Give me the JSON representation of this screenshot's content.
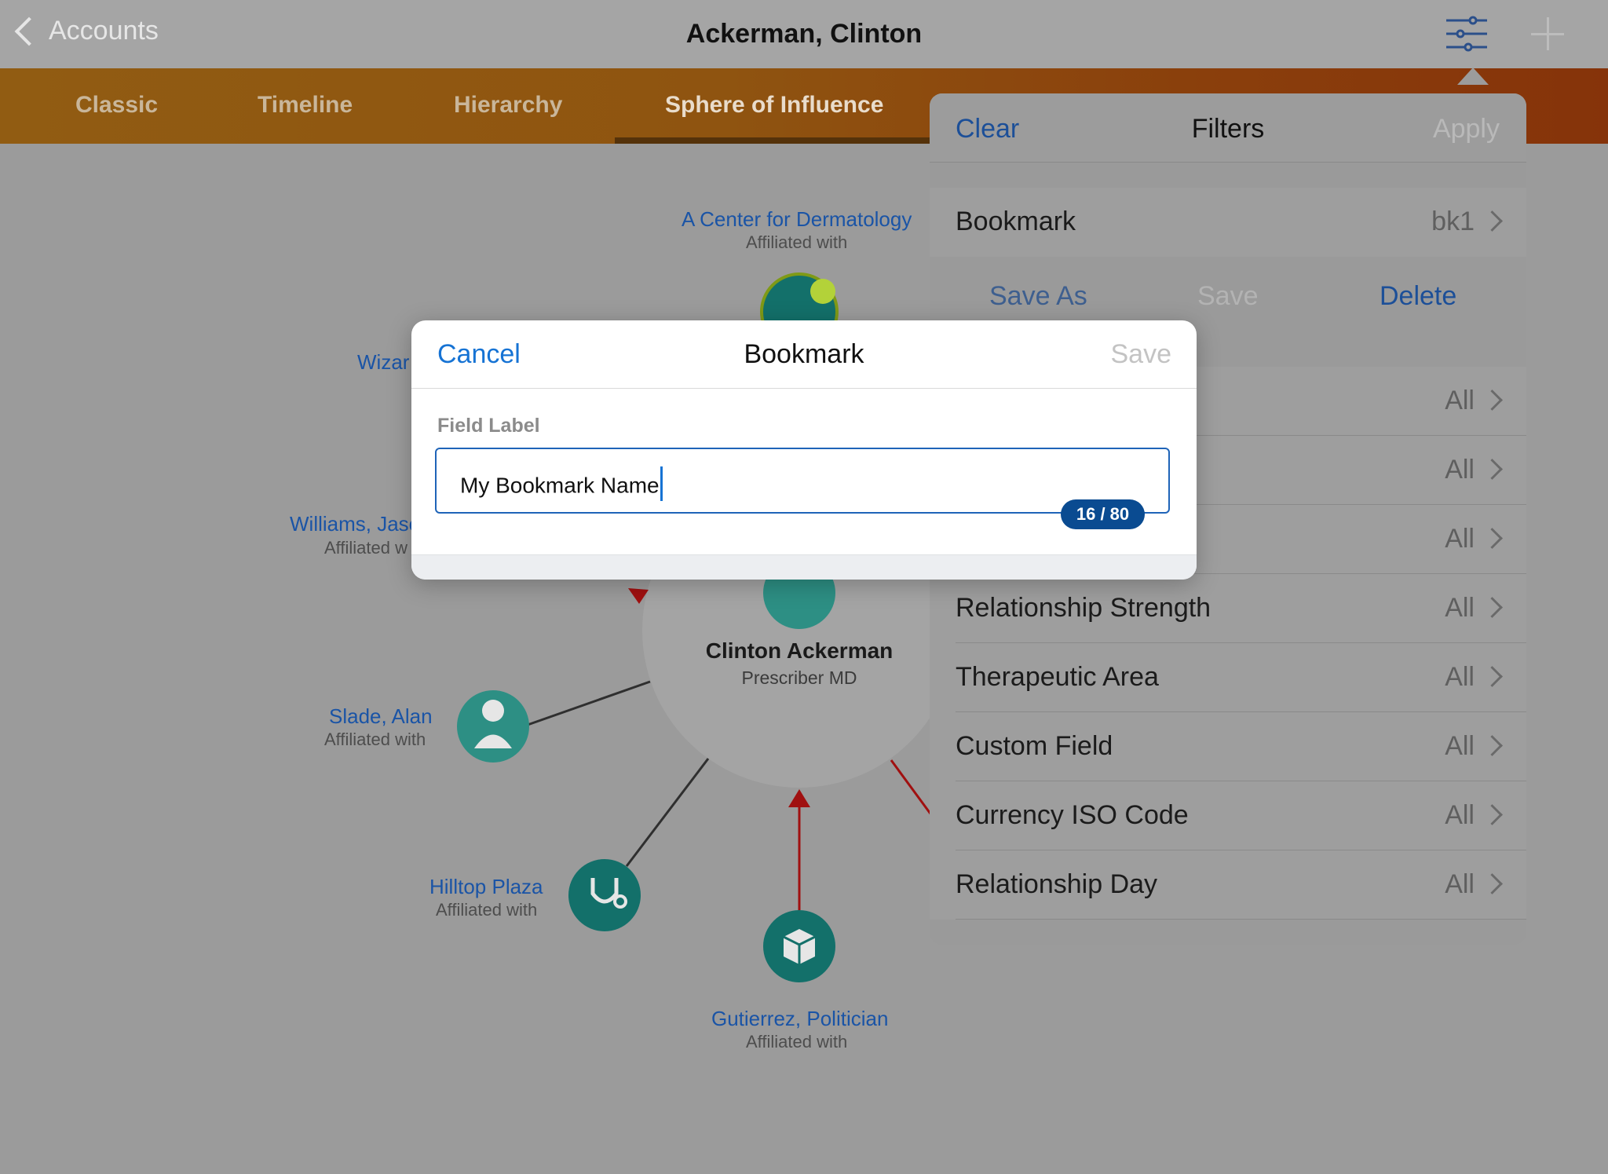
{
  "nav": {
    "back_label": "Accounts",
    "title": "Ackerman, Clinton",
    "filter_icon": "sliders-icon",
    "add_icon": "plus-icon"
  },
  "tabs": [
    {
      "label": "Classic"
    },
    {
      "label": "Timeline"
    },
    {
      "label": "Hierarchy"
    },
    {
      "label": "Sphere of Influence",
      "active": true
    }
  ],
  "graph": {
    "center": {
      "name": "Clinton Ackerman",
      "subtitle": "Prescriber MD"
    },
    "nodes": [
      {
        "name": "A Center for Dermatology",
        "relation": "Affiliated with",
        "icon": "stethoscope-icon"
      },
      {
        "name": "Wizar",
        "relation": "",
        "icon": ""
      },
      {
        "name": "Williams, Jaso",
        "relation": "Affiliated w",
        "icon": ""
      },
      {
        "name": "Slade, Alan",
        "relation": "Affiliated with",
        "icon": "doctor-icon"
      },
      {
        "name": "Hilltop Plaza",
        "relation": "Affiliated with",
        "icon": "stethoscope-icon"
      },
      {
        "name": "Gutierrez, Politician",
        "relation": "Affiliated with",
        "icon": "package-icon"
      }
    ],
    "colors": {
      "node_teal": "#13706a",
      "node_light": "#2d8f84",
      "arrow_red": "#a01010",
      "badge_green": "#b3d239"
    }
  },
  "filters": {
    "clear_label": "Clear",
    "title": "Filters",
    "apply_label": "Apply",
    "bookmark": {
      "label": "Bookmark",
      "value": "bk1"
    },
    "actions": {
      "save_as": "Save As",
      "save": "Save",
      "delete": "Delete"
    },
    "rows": [
      {
        "label": "",
        "value": "All"
      },
      {
        "label": "",
        "value": "All"
      },
      {
        "label": "",
        "value": "All"
      },
      {
        "label": "Relationship Strength",
        "value": "All"
      },
      {
        "label": "Therapeutic Area",
        "value": "All"
      },
      {
        "label": "Custom Field",
        "value": "All"
      },
      {
        "label": "Currency ISO Code",
        "value": "All"
      },
      {
        "label": "Relationship Day",
        "value": "All"
      }
    ]
  },
  "modal": {
    "cancel_label": "Cancel",
    "title": "Bookmark",
    "save_label": "Save",
    "field_label": "Field Label",
    "input_value": "My Bookmark Name",
    "counter": "16 / 80"
  }
}
